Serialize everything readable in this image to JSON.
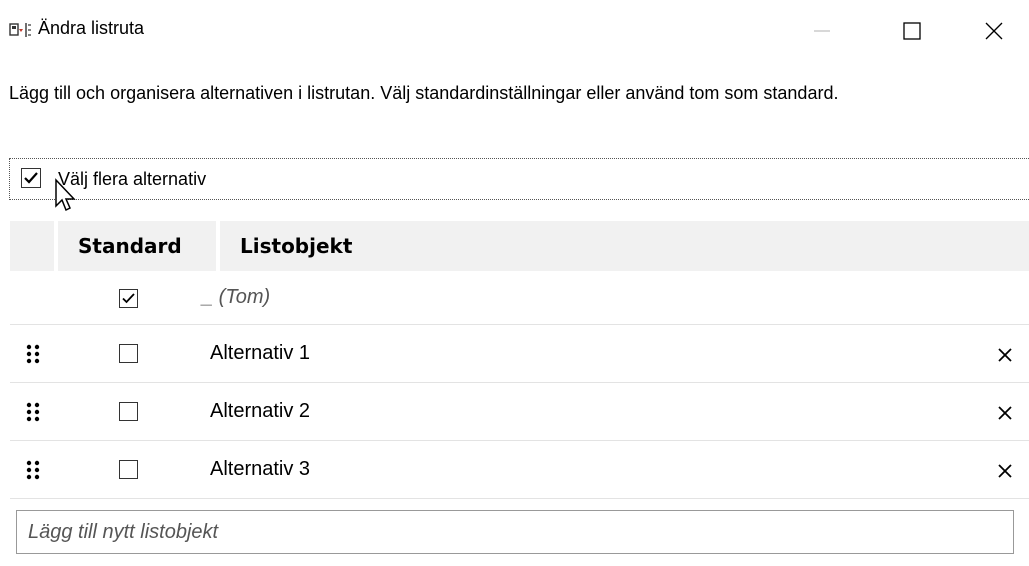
{
  "window": {
    "title": "Ändra listruta",
    "icons": {
      "app": "list-box-icon",
      "minimize": "minimize-icon",
      "maximize": "maximize-icon",
      "close": "close-icon"
    }
  },
  "description": "Lägg till och organisera alternativen i listrutan. Välj standardinställningar eller använd tom som standard.",
  "multi_select": {
    "label": "Välj flera alternativ",
    "checked": true
  },
  "table": {
    "headers": {
      "standard": "Standard",
      "item": "Listobjekt"
    },
    "rows": [
      {
        "label": "_ (Tom)",
        "default_checked": true,
        "draggable": false,
        "removable": false
      },
      {
        "label": "Alternativ 1",
        "default_checked": false,
        "draggable": true,
        "removable": true
      },
      {
        "label": "Alternativ 2",
        "default_checked": false,
        "draggable": true,
        "removable": true
      },
      {
        "label": "Alternativ 3",
        "default_checked": false,
        "draggable": true,
        "removable": true
      }
    ],
    "row_icons": {
      "drag": "drag-handle-icon",
      "remove": "remove-icon"
    }
  },
  "add_item": {
    "placeholder": "Lägg till nytt listobjekt",
    "value": ""
  }
}
